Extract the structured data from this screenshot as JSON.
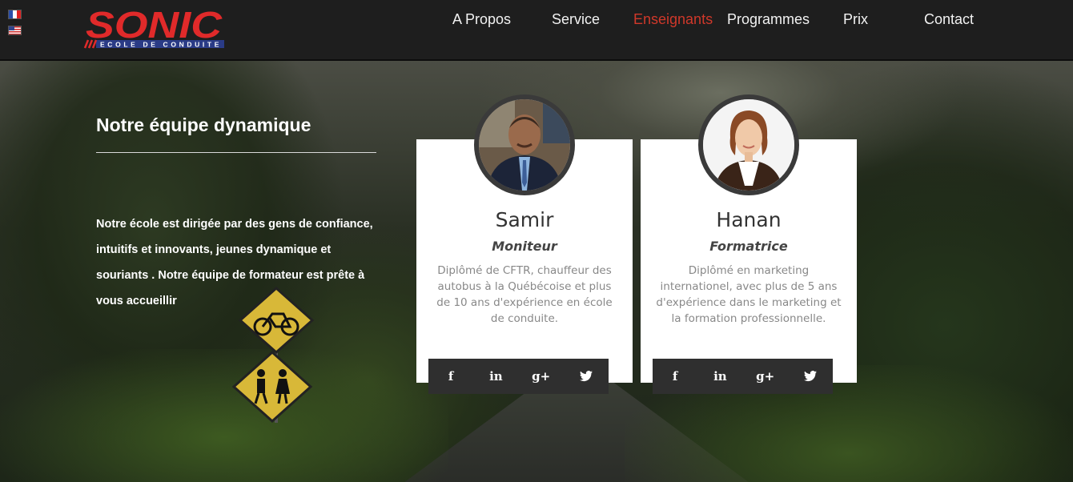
{
  "nav": {
    "languages": [
      "Français",
      "English"
    ],
    "logo": {
      "brand": "SONIC",
      "tagline": "ECOLE DE CONDUITE"
    },
    "menu": [
      "A Propos",
      "Service",
      "Enseignants",
      "Programmes",
      "Prix",
      "Contact"
    ],
    "active_item": "Enseignants",
    "colors": {
      "background": "#1e1e1e",
      "accent": "#d0382a",
      "logo_band": "#2a3b86"
    }
  },
  "hero": {
    "title": "Notre équipe dynamique",
    "description": "Notre école est dirigée par des gens de confiance, intuitifs et innovants, jeunes dynamique et souriants . Notre équipe de formateur est prête à vous accueillir",
    "signs": [
      "bicycle-sign",
      "pedestrian-sign"
    ]
  },
  "team": [
    {
      "name": "Samir",
      "role": "Moniteur",
      "bio": "Diplômé de CFTR, chauffeur des autobus à la Québécoise et plus de 10 ans d'expérience en école de conduite.",
      "social": {
        "facebook": "f",
        "linkedin": "in",
        "googleplus": "g+",
        "twitter": "twitter-bird"
      }
    },
    {
      "name": "Hanan",
      "role": "Formatrice",
      "bio": "Diplômé en marketing internationel, avec plus de 5 ans d'expérience dans le marketing et la formation professionnelle.",
      "social": {
        "facebook": "f",
        "linkedin": "in",
        "googleplus": "g+",
        "twitter": "twitter-bird"
      }
    }
  ]
}
